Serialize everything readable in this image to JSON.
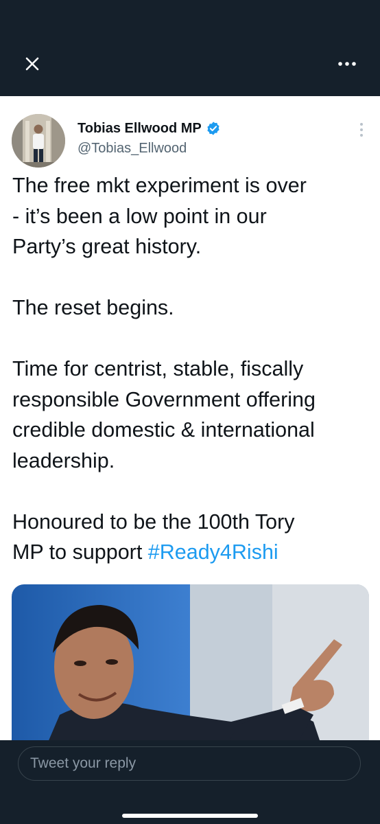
{
  "header": {
    "close_icon": "close-icon",
    "more_icon": "more-horizontal-icon",
    "background": "#15202b"
  },
  "tweet": {
    "author": {
      "name": "Tobias Ellwood MP",
      "handle": "@Tobias_Ellwood",
      "verified": true,
      "verified_color": "#1d9bf0"
    },
    "paragraphs": [
      "The free mkt experiment is over\n- it’s been a low point in our\nParty’s great history.",
      "The reset begins.",
      "Time for centrist, stable, fiscally\nresponsible Government offering\ncredible domestic & international\nleadership."
    ],
    "last_paragraph_text": "Honoured to be the 100th Tory\nMP to support ",
    "hashtag": "#Ready4Rishi",
    "hashtag_color": "#1d9bf0",
    "actions": [
      "reply-icon",
      "retweet-icon",
      "like-icon",
      "share-icon"
    ]
  },
  "reply": {
    "placeholder": "Tweet your reply"
  }
}
